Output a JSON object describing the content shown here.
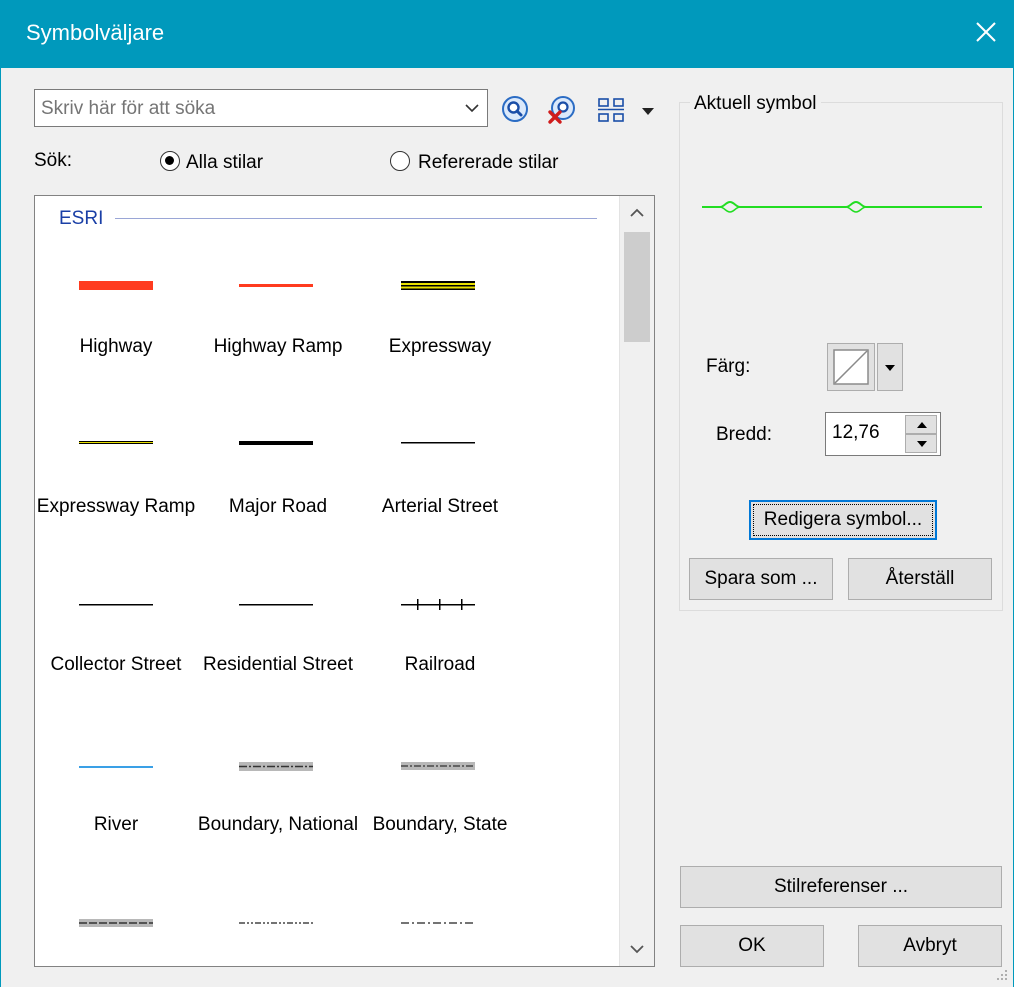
{
  "window": {
    "title": "Symbolväljare"
  },
  "search": {
    "placeholder": "Skriv här för att söka",
    "value": ""
  },
  "search_scope": {
    "label": "Sök:",
    "options": [
      {
        "label": "Alla stilar",
        "selected": true
      },
      {
        "label": "Refererade stilar",
        "selected": false
      }
    ]
  },
  "symbol_list": {
    "group": "ESRI",
    "items": [
      {
        "name": "Highway"
      },
      {
        "name": "Highway Ramp"
      },
      {
        "name": "Expressway"
      },
      {
        "name": "Expressway Ramp"
      },
      {
        "name": "Major Road"
      },
      {
        "name": "Arterial Street"
      },
      {
        "name": "Collector Street"
      },
      {
        "name": "Residential Street"
      },
      {
        "name": "Railroad"
      },
      {
        "name": "River"
      },
      {
        "name": "Boundary, National"
      },
      {
        "name": "Boundary, State"
      },
      {
        "name": ""
      },
      {
        "name": ""
      },
      {
        "name": ""
      }
    ]
  },
  "current_symbol": {
    "title": "Aktuell symbol",
    "color_label": "Färg:",
    "width_label": "Bredd:",
    "width_value": "12,76",
    "preview_color": "#00dd00",
    "edit_button": "Redigera symbol...",
    "save_as_button": "Spara som ...",
    "reset_button": "Återställ"
  },
  "footer": {
    "style_refs_button": "Stilreferenser ...",
    "ok_button": "OK",
    "cancel_button": "Avbryt"
  },
  "colors": {
    "titlebar": "#0099bc",
    "highway": "#ff3b1f",
    "highway_ramp": "#ff3b1f",
    "expressway": "#7a6d00",
    "river": "#3aa0e6"
  }
}
